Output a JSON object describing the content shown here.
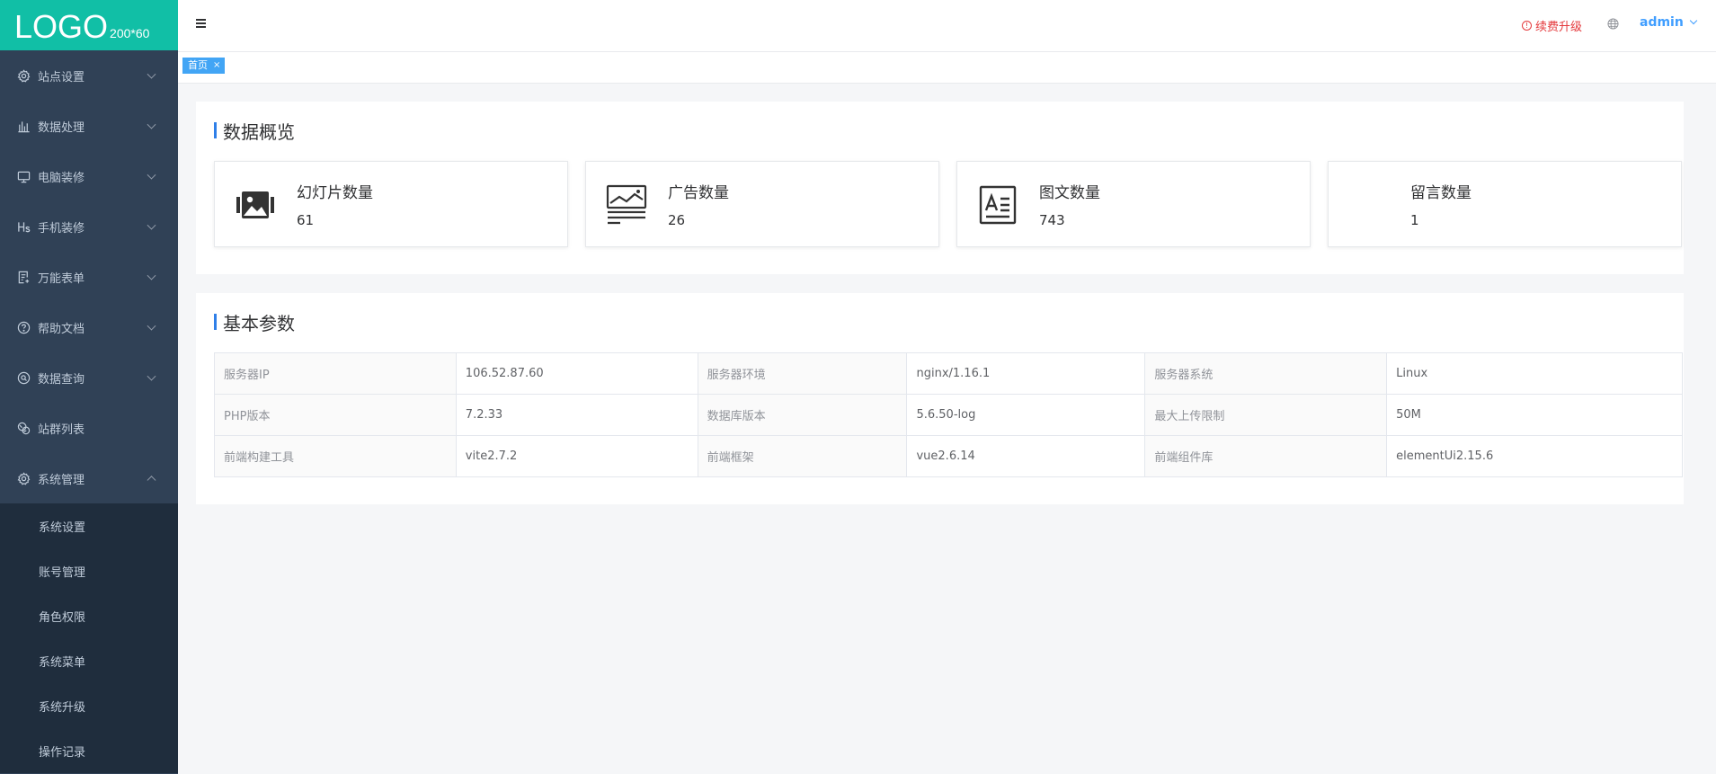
{
  "logo": {
    "main": "LOGO",
    "size": "200*60"
  },
  "sidebar": {
    "items": [
      {
        "label": "站点设置",
        "icon": "gear-icon"
      },
      {
        "label": "数据处理",
        "icon": "bar-chart-icon"
      },
      {
        "label": "电脑装修",
        "icon": "monitor-icon"
      },
      {
        "label": "手机装修",
        "icon": "heading-icon"
      },
      {
        "label": "万能表单",
        "icon": "form-icon"
      },
      {
        "label": "帮助文档",
        "icon": "question-icon"
      },
      {
        "label": "数据查询",
        "icon": "search-circle-icon"
      },
      {
        "label": "站群列表",
        "icon": "globe-group-icon"
      },
      {
        "label": "系统管理",
        "icon": "gear-icon"
      }
    ],
    "system_submenu": [
      "系统设置",
      "账号管理",
      "角色权限",
      "系统菜单",
      "系统升级",
      "操作记录"
    ]
  },
  "header": {
    "upgrade": "续费升级",
    "user": "admin"
  },
  "tabs": [
    {
      "label": "首页",
      "close": "×"
    }
  ],
  "overview": {
    "title": "数据概览",
    "cards": [
      {
        "label": "幻灯片数量",
        "value": "61",
        "icon": "slides-icon"
      },
      {
        "label": "广告数量",
        "value": "26",
        "icon": "ad-icon"
      },
      {
        "label": "图文数量",
        "value": "743",
        "icon": "article-icon"
      },
      {
        "label": "留言数量",
        "value": "1",
        "icon": "message-icon"
      }
    ]
  },
  "params": {
    "title": "基本参数",
    "rows": [
      [
        {
          "k": "服务器IP",
          "v": "106.52.87.60"
        },
        {
          "k": "服务器环境",
          "v": "nginx/1.16.1"
        },
        {
          "k": "服务器系统",
          "v": "Linux"
        }
      ],
      [
        {
          "k": "PHP版本",
          "v": "7.2.33"
        },
        {
          "k": "数据库版本",
          "v": "5.6.50-log"
        },
        {
          "k": "最大上传限制",
          "v": "50M"
        }
      ],
      [
        {
          "k": "前端构建工具",
          "v": "vite2.7.2"
        },
        {
          "k": "前端框架",
          "v": "vue2.6.14"
        },
        {
          "k": "前端组件库",
          "v": "elementUi2.15.6"
        }
      ]
    ]
  },
  "colors": {
    "sidebar": "#304156",
    "submenu": "#1f2d3d",
    "logo": "#11bfa6",
    "accent": "#409eff",
    "warn": "#e4393c"
  }
}
